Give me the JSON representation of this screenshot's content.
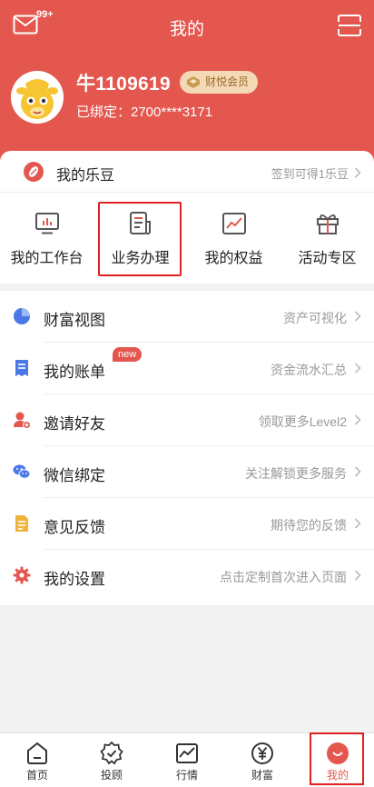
{
  "header": {
    "title": "我的",
    "mail_badge": "99+",
    "username": "牛1109619",
    "member_badge": "财悦会员",
    "bound_label": "已绑定：2700****3171"
  },
  "ledou": {
    "label": "我的乐豆",
    "hint": "签到可得1乐豆"
  },
  "quick_actions": [
    {
      "label": "我的工作台",
      "icon": "monitor-chart-icon"
    },
    {
      "label": "业务办理",
      "icon": "document-icon"
    },
    {
      "label": "我的权益",
      "icon": "trend-chart-icon"
    },
    {
      "label": "活动专区",
      "icon": "gift-icon"
    }
  ],
  "menu": [
    {
      "label": "财富视图",
      "hint": "资产可视化",
      "icon": "pie-chart-icon"
    },
    {
      "label": "我的账单",
      "hint": "资金流水汇总",
      "icon": "bill-icon",
      "badge": "new"
    },
    {
      "label": "邀请好友",
      "hint": "领取更多Level2",
      "icon": "add-user-icon"
    },
    {
      "label": "微信绑定",
      "hint": "关注解锁更多服务",
      "icon": "wechat-icon"
    },
    {
      "label": "意见反馈",
      "hint": "期待您的反馈",
      "icon": "feedback-icon"
    },
    {
      "label": "我的设置",
      "hint": "点击定制首次进入页面",
      "icon": "gear-icon"
    }
  ],
  "tabs": [
    {
      "label": "首页",
      "icon": "home-icon"
    },
    {
      "label": "投顾",
      "icon": "advisor-icon"
    },
    {
      "label": "行情",
      "icon": "market-icon"
    },
    {
      "label": "财富",
      "icon": "yuan-icon"
    },
    {
      "label": "我的",
      "icon": "profile-icon",
      "active": true
    }
  ],
  "colors": {
    "brand": "#e3574f",
    "focus_outline": "#e02020",
    "member_badge_bg": "#f3d9b5"
  }
}
